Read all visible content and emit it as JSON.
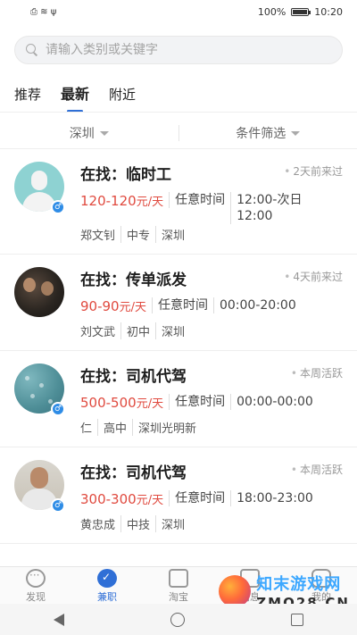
{
  "status_bar": {
    "battery": "100%",
    "time": "10:20",
    "left_icons": "⎙ ≋ ψ"
  },
  "search": {
    "placeholder": "请输入类别或关键字"
  },
  "tabs": [
    {
      "label": "推荐",
      "active": false
    },
    {
      "label": "最新",
      "active": true
    },
    {
      "label": "附近",
      "active": false
    }
  ],
  "filters": {
    "city": "深圳",
    "conditions": "条件筛选"
  },
  "jobs": [
    {
      "title": "在找：临时工",
      "active": "2天前来过",
      "salary": "120-120",
      "unit": "元/天",
      "time": "任意时间",
      "hours": "12:00-次日12:00",
      "name": "郑文钊",
      "edu": "中专",
      "location": "深圳",
      "gender": "♂"
    },
    {
      "title": "在找：传单派发",
      "active": "4天前来过",
      "salary": "90-90",
      "unit": "元/天",
      "time": "任意时间",
      "hours": "00:00-20:00",
      "name": "刘文武",
      "edu": "初中",
      "location": "深圳",
      "gender": ""
    },
    {
      "title": "在找：司机代驾",
      "active": "本周活跃",
      "salary": "500-500",
      "unit": "元/天",
      "time": "任意时间",
      "hours": "00:00-00:00",
      "name": "仁",
      "edu": "高中",
      "location": "深圳光明新",
      "gender": "♂"
    },
    {
      "title": "在找：司机代驾",
      "active": "本周活跃",
      "salary": "300-300",
      "unit": "元/天",
      "time": "任意时间",
      "hours": "18:00-23:00",
      "name": "黄忠成",
      "edu": "中技",
      "location": "深圳",
      "gender": "♂"
    }
  ],
  "bottom_nav": [
    {
      "label": "发现",
      "icon": "discover-icon",
      "active": false
    },
    {
      "label": "兼职",
      "icon": "parttime-icon",
      "active": true
    },
    {
      "label": "淘宝",
      "icon": "shop-icon",
      "active": false
    },
    {
      "label": "消息",
      "icon": "message-icon",
      "active": false
    },
    {
      "label": "我的",
      "icon": "mine-icon",
      "active": false
    }
  ],
  "watermark": {
    "title": "知末游戏网",
    "url": "ZMO28.CN"
  },
  "colors": {
    "accent": "#2f6fd6",
    "salary": "#e04a3f",
    "gender_badge": "#2e8ce6"
  }
}
